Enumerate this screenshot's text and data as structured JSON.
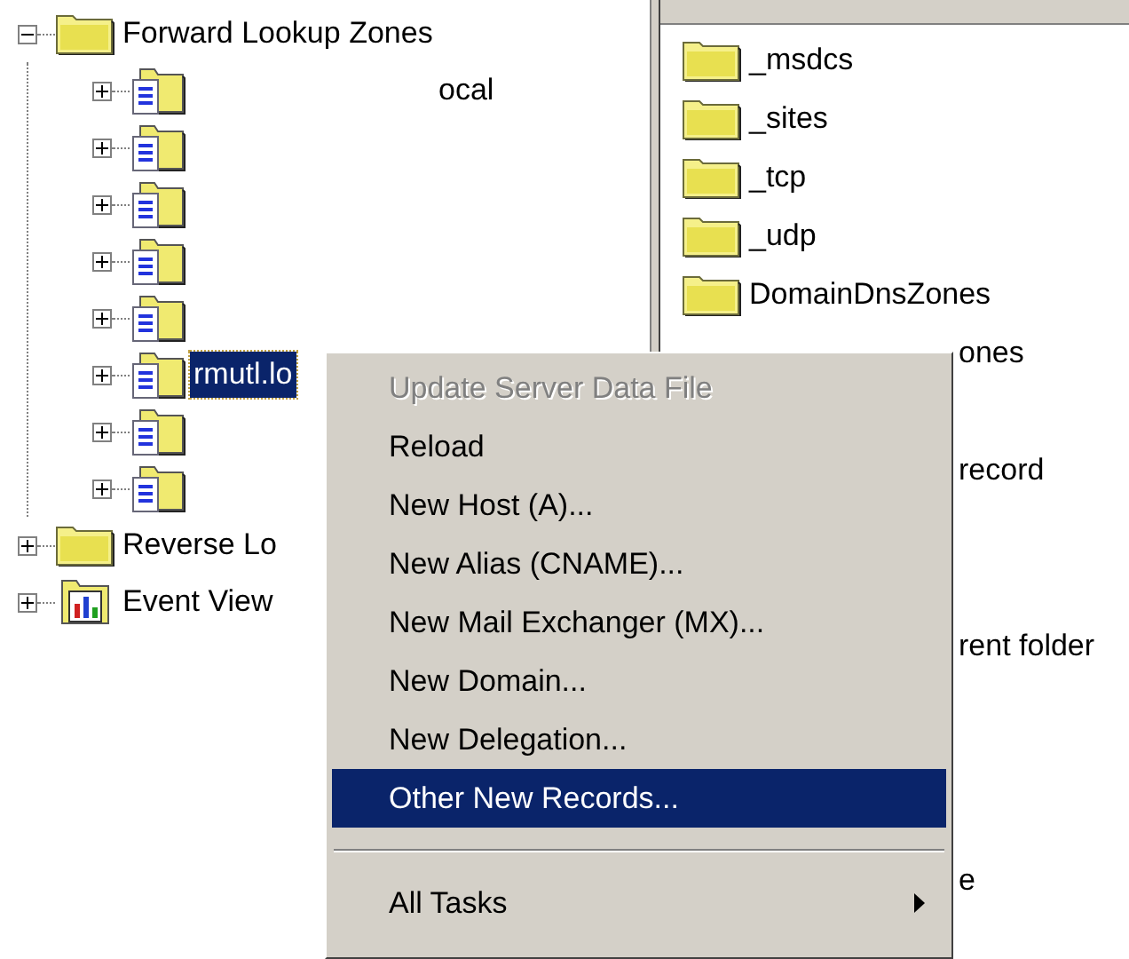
{
  "tree": [
    {
      "label": "Forward Lookup Zones",
      "expanded": true,
      "kind": "folder",
      "children": [
        {
          "kind": "zone",
          "label": "ocal",
          "selected": false,
          "expanded": false
        },
        {
          "kind": "zone",
          "expanded": false
        },
        {
          "kind": "zone",
          "expanded": false
        },
        {
          "kind": "zone",
          "expanded": false
        },
        {
          "kind": "zone",
          "expanded": false
        },
        {
          "kind": "zone",
          "label": "rmutl.lo",
          "selected": true,
          "expanded": false
        },
        {
          "kind": "zone",
          "expanded": false
        },
        {
          "kind": "zone",
          "expanded": false
        }
      ]
    },
    {
      "label": "Reverse Lo",
      "expanded": false,
      "kind": "folder"
    },
    {
      "label": "Event View",
      "expanded": false,
      "kind": "events"
    }
  ],
  "list": {
    "rows": [
      {
        "kind": "folder",
        "name": "_msdcs"
      },
      {
        "kind": "folder",
        "name": "_sites"
      },
      {
        "kind": "folder",
        "name": "_tcp"
      },
      {
        "kind": "folder",
        "name": "_udp"
      },
      {
        "kind": "folder",
        "name": "DomainDnsZones"
      },
      {
        "kind": "covered",
        "name": "ones"
      },
      {
        "kind": "blank"
      },
      {
        "kind": "covered",
        "name": "record"
      },
      {
        "kind": "blank"
      },
      {
        "kind": "blank"
      },
      {
        "kind": "covered",
        "name": "rent folder"
      },
      {
        "kind": "blank"
      },
      {
        "kind": "blank"
      },
      {
        "kind": "blank"
      },
      {
        "kind": "covered",
        "name": "e"
      }
    ]
  },
  "context_menu": [
    {
      "kind": "item",
      "label": "Update Server Data File",
      "disabled": true,
      "selected": false
    },
    {
      "kind": "item",
      "label": "Reload",
      "disabled": false,
      "selected": false
    },
    {
      "kind": "item",
      "label": "New Host (A)...",
      "disabled": false,
      "selected": false
    },
    {
      "kind": "item",
      "label": "New Alias (CNAME)...",
      "disabled": false,
      "selected": false
    },
    {
      "kind": "item",
      "label": "New Mail Exchanger (MX)...",
      "disabled": false,
      "selected": false
    },
    {
      "kind": "item",
      "label": "New Domain...",
      "disabled": false,
      "selected": false
    },
    {
      "kind": "item",
      "label": "New Delegation...",
      "disabled": false,
      "selected": false
    },
    {
      "kind": "item",
      "label": "Other New Records...",
      "disabled": false,
      "selected": true
    },
    {
      "kind": "separator"
    },
    {
      "kind": "submenu",
      "label": "All Tasks",
      "disabled": false,
      "selected": false
    }
  ]
}
